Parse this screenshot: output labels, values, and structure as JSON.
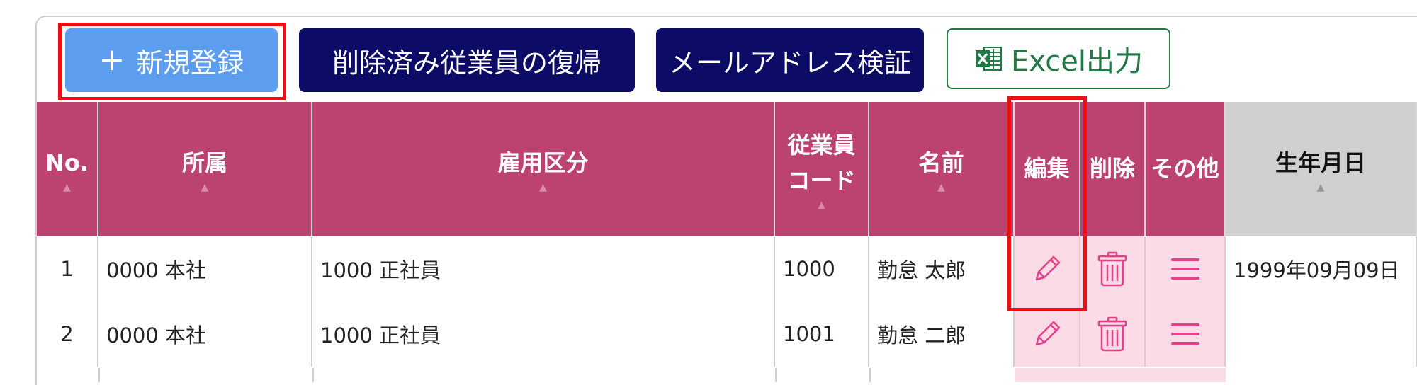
{
  "toolbar": {
    "new_label": "新規登録",
    "restore_label": "削除済み従業員の復帰",
    "verify_label": "メールアドレス検証",
    "excel_label": "Excel出力"
  },
  "table": {
    "headers": {
      "no": "No.",
      "affiliation": "所属",
      "employment_type": "雇用区分",
      "code_line1": "従業員",
      "code_line2": "コード",
      "name": "名前",
      "edit": "編集",
      "delete": "削除",
      "other": "その他",
      "birthdate": "生年月日"
    },
    "rows": [
      {
        "no": "1",
        "affiliation": "0000 本社",
        "employment_type": "1000 正社員",
        "code": "1000",
        "name": "勤怠 太郎",
        "birthdate": "1999年09月09日"
      },
      {
        "no": "2",
        "affiliation": "0000 本社",
        "employment_type": "1000 正社員",
        "code": "1001",
        "name": "勤怠 二郎",
        "birthdate": ""
      }
    ]
  },
  "colors": {
    "header_bg": "#bc4270",
    "action_cell_bg": "#fadbe6",
    "new_button": "#5d9df0",
    "dark_button": "#0c0b66",
    "excel_green": "#1f7a45",
    "highlight": "#ef0d14"
  },
  "icons": {
    "plus": "plus-icon",
    "excel": "excel-icon",
    "edit": "pencil-icon",
    "delete": "trash-icon",
    "other": "hamburger-menu-icon",
    "sort": "sort-arrow-icon"
  }
}
